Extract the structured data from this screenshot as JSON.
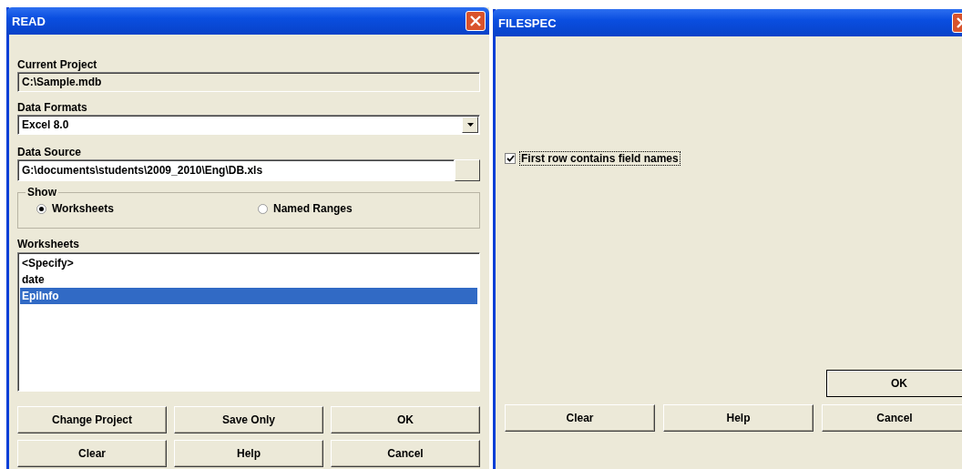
{
  "read_dialog": {
    "title": "READ",
    "current_project": {
      "label": "Current Project",
      "value": "C:\\Sample.mdb"
    },
    "data_formats": {
      "label": "Data Formats",
      "value": "Excel 8.0"
    },
    "data_source": {
      "label": "Data Source",
      "value": "G:\\documents\\students\\2009_2010\\Eng\\DB.xls"
    },
    "show": {
      "label": "Show",
      "options": [
        {
          "label": "Worksheets",
          "selected": true
        },
        {
          "label": "Named Ranges",
          "selected": false
        }
      ]
    },
    "worksheets": {
      "label": "Worksheets",
      "items": [
        {
          "label": "<Specify>",
          "selected": false
        },
        {
          "label": "date",
          "selected": false
        },
        {
          "label": "EpiInfo",
          "selected": true
        }
      ]
    },
    "buttons": [
      [
        "Change Project",
        "Save Only",
        "OK"
      ],
      [
        "Clear",
        "Help",
        "Cancel"
      ]
    ]
  },
  "filespec_dialog": {
    "title": "FILESPEC",
    "checkbox": {
      "label": "First row contains field names",
      "checked": true
    },
    "ok_button": "OK",
    "buttons": [
      "Clear",
      "Help",
      "Cancel"
    ]
  }
}
